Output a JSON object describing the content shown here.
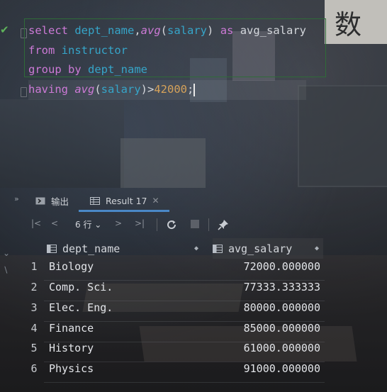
{
  "editor": {
    "status_icon": "check-icon",
    "lines": [
      {
        "tokens": [
          [
            "kw",
            "select "
          ],
          [
            "id",
            "dept_name"
          ],
          [
            "plain",
            ","
          ],
          [
            "fn",
            "avg"
          ],
          [
            "plain",
            "("
          ],
          [
            "id",
            "salary"
          ],
          [
            "plain",
            ") "
          ],
          [
            "kw",
            "as "
          ],
          [
            "plain",
            "avg_salary"
          ]
        ]
      },
      {
        "tokens": [
          [
            "kw",
            "from "
          ],
          [
            "id",
            "instructor"
          ]
        ]
      },
      {
        "tokens": [
          [
            "kw",
            "group by "
          ],
          [
            "id",
            "dept_name"
          ]
        ]
      },
      {
        "tokens": [
          [
            "kw",
            "having "
          ],
          [
            "fn",
            "avg"
          ],
          [
            "plain",
            "("
          ],
          [
            "id",
            "salary"
          ],
          [
            "plain",
            ")>"
          ],
          [
            "num",
            "42000"
          ],
          [
            "plain",
            ";"
          ]
        ]
      }
    ]
  },
  "tabs": {
    "output_label": "输出",
    "result_label": "Result 17"
  },
  "toolbar": {
    "row_count": "6 行"
  },
  "results": {
    "columns": [
      "dept_name",
      "avg_salary"
    ],
    "rows": [
      {
        "n": "1",
        "dept_name": "Biology",
        "avg_salary": "72000.000000"
      },
      {
        "n": "2",
        "dept_name": "Comp. Sci.",
        "avg_salary": "77333.333333"
      },
      {
        "n": "3",
        "dept_name": "Elec. Eng.",
        "avg_salary": "80000.000000"
      },
      {
        "n": "4",
        "dept_name": "Finance",
        "avg_salary": "85000.000000"
      },
      {
        "n": "5",
        "dept_name": "History",
        "avg_salary": "61000.000000"
      },
      {
        "n": "6",
        "dept_name": "Physics",
        "avg_salary": "91000.000000"
      }
    ]
  },
  "background": {
    "overlay_character": "数"
  },
  "colors": {
    "keyword": "#cc7ad6",
    "identifier": "#36a5c9",
    "number": "#d6a25a",
    "accent": "#4a88c7",
    "check": "#5fb35b"
  }
}
